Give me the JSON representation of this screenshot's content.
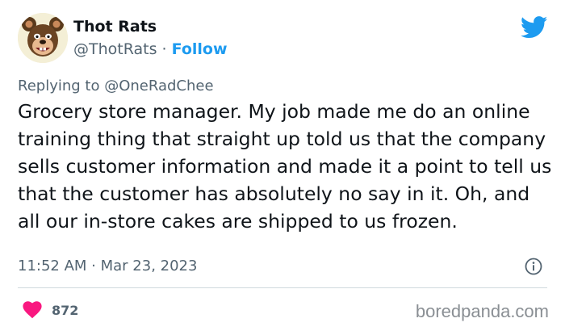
{
  "author": {
    "display_name": "Thot Rats",
    "handle": "@ThotRats",
    "separator": " · ",
    "follow_label": "Follow",
    "avatar_icon": "cartoon-rat-avatar"
  },
  "brand_icon": "twitter-bird-icon",
  "reply": {
    "prefix": "Replying to ",
    "target": "@OneRadChee"
  },
  "body": "Grocery store manager. My job made me do an online training thing that straight up told us that the company sells customer information and made it a point to tell us that the customer has absolutely no say in it. Oh, and all our in-store cakes are shipped to us frozen.",
  "timestamp": "11:52 AM · Mar 23, 2023",
  "likes": {
    "count": "872",
    "icon": "heart-icon"
  },
  "watermark": "boredpanda.com",
  "colors": {
    "accent": "#1d9bf0",
    "heart": "#f91880",
    "text": "#0f1419",
    "secondary": "#536471",
    "divider": "#cfd9de"
  }
}
